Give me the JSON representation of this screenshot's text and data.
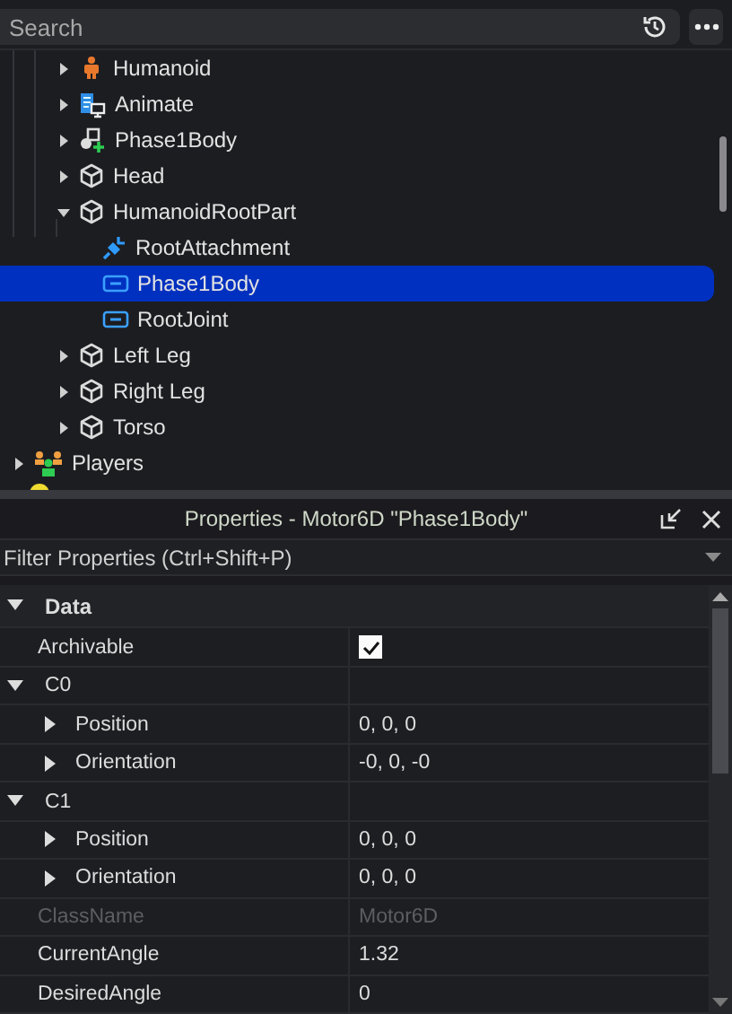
{
  "explorer": {
    "search": {
      "placeholder": "Search"
    },
    "model_children": [
      {
        "label": "Humanoid",
        "kind": "humanoid",
        "expanded": false,
        "selected": false
      },
      {
        "label": "Animate",
        "kind": "script",
        "expanded": false,
        "selected": false
      },
      {
        "label": "Phase1Body",
        "kind": "model",
        "expanded": false,
        "selected": false
      },
      {
        "label": "Head",
        "kind": "part",
        "expanded": false,
        "selected": false
      },
      {
        "label": "HumanoidRootPart",
        "kind": "part",
        "expanded": true,
        "selected": false,
        "children": [
          {
            "label": "RootAttachment",
            "kind": "attachment",
            "selected": false
          },
          {
            "label": "Phase1Body",
            "kind": "joint",
            "selected": true
          },
          {
            "label": "RootJoint",
            "kind": "joint",
            "selected": false
          }
        ]
      },
      {
        "label": "Left Leg",
        "kind": "part",
        "expanded": false,
        "selected": false
      },
      {
        "label": "Right Leg",
        "kind": "part",
        "expanded": false,
        "selected": false
      },
      {
        "label": "Torso",
        "kind": "part",
        "expanded": false,
        "selected": false
      }
    ],
    "service_items": [
      {
        "label": "Players",
        "kind": "players",
        "expanded": false,
        "selected": false
      }
    ]
  },
  "properties": {
    "title": "Properties - Motor6D \"Phase1Body\"",
    "filter": {
      "placeholder": "Filter Properties (Ctrl+Shift+P)"
    },
    "categories": [
      {
        "label": "Data",
        "expanded": true,
        "rows": [
          {
            "name": "Archivable",
            "kind": "bool",
            "checked": true
          },
          {
            "name": "C0",
            "kind": "group",
            "expanded": true,
            "children": [
              {
                "name": "Position",
                "value": "0, 0, 0",
                "expanded": false
              },
              {
                "name": "Orientation",
                "value": "-0, 0, -0",
                "expanded": false
              }
            ]
          },
          {
            "name": "C1",
            "kind": "group",
            "expanded": true,
            "children": [
              {
                "name": "Position",
                "value": "0, 0, 0",
                "expanded": false
              },
              {
                "name": "Orientation",
                "value": "0, 0, 0",
                "expanded": false
              }
            ]
          },
          {
            "name": "ClassName",
            "kind": "text",
            "value": "Motor6D",
            "disabled": true
          },
          {
            "name": "CurrentAngle",
            "kind": "text",
            "value": "1.32",
            "disabled": false
          },
          {
            "name": "DesiredAngle",
            "kind": "text",
            "value": "0",
            "disabled": false
          }
        ]
      }
    ]
  }
}
